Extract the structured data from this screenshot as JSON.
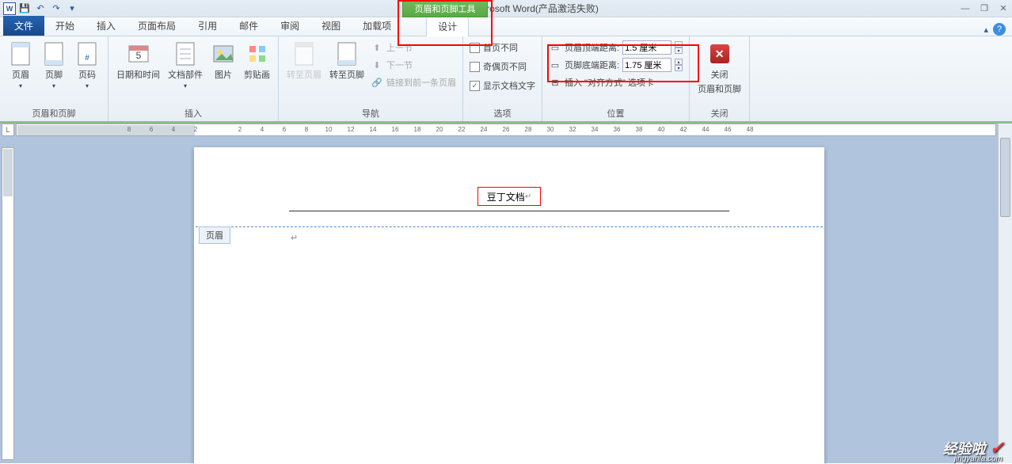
{
  "title": "文档2 - Microsoft Word(产品激活失败)",
  "contextual_tab": "页眉和页脚工具",
  "tabs": {
    "file": "文件",
    "home": "开始",
    "insert": "插入",
    "layout": "页面布局",
    "references": "引用",
    "mailings": "邮件",
    "review": "审阅",
    "view": "视图",
    "addins": "加载项",
    "design": "设计"
  },
  "ribbon": {
    "hf_group": "页眉和页脚",
    "header": "页眉",
    "footer": "页脚",
    "page_number": "页码",
    "insert_group": "插入",
    "datetime": "日期和时间",
    "doc_parts": "文档部件",
    "picture": "图片",
    "clipart": "剪贴画",
    "nav_group": "导航",
    "goto_header": "转至页眉",
    "goto_footer": "转至页脚",
    "prev": "上一节",
    "next": "下一节",
    "link_prev": "链接到前一条页眉",
    "options_group": "选项",
    "first_diff": "首页不同",
    "odd_even_diff": "奇偶页不同",
    "show_doc_text": "显示文档文字",
    "position_group": "位置",
    "header_top": "页眉顶端距离:",
    "header_top_val": "1.5 厘米",
    "footer_bottom": "页脚底端距离:",
    "footer_bottom_val": "1.75 厘米",
    "insert_align_tab": "插入 \"对齐方式\" 选项卡",
    "close_group": "关闭",
    "close_hf": "关闭",
    "close_hf2": "页眉和页脚"
  },
  "ruler_nums": [
    "8",
    "6",
    "4",
    "2",
    "",
    "2",
    "4",
    "6",
    "8",
    "10",
    "12",
    "14",
    "16",
    "18",
    "20",
    "22",
    "24",
    "26",
    "28",
    "30",
    "32",
    "34",
    "36",
    "38",
    "40",
    "42",
    "44",
    "46",
    "48"
  ],
  "doc": {
    "header_text": "豆丁文档",
    "header_tag": "页眉"
  },
  "watermark": {
    "main": "经验啦",
    "sub": "jingyanla.com"
  }
}
